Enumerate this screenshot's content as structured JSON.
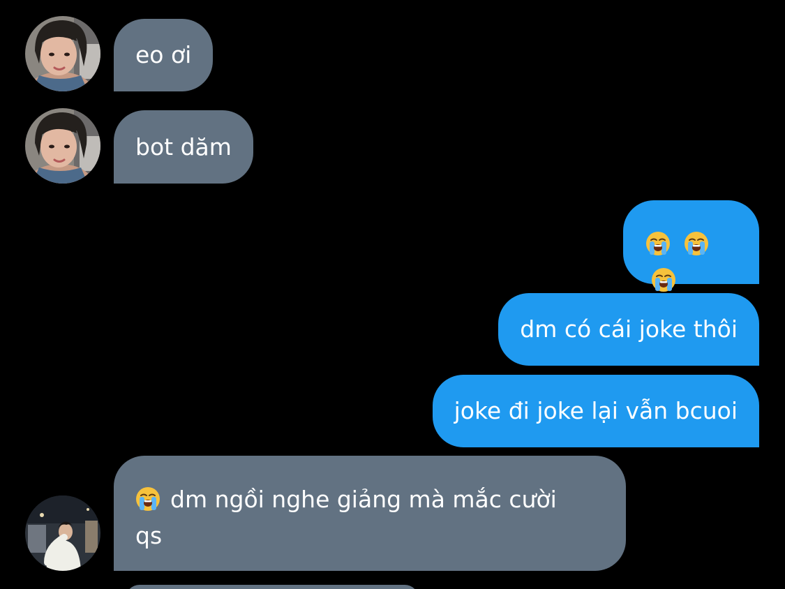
{
  "messages": [
    {
      "sender": "other",
      "text": "eo ơi"
    },
    {
      "sender": "other",
      "text": "bot dăm"
    },
    {
      "sender": "me",
      "emoji": [
        "loudly-crying-face",
        "loudly-crying-face",
        "loudly-crying-face"
      ]
    },
    {
      "sender": "me",
      "text": "dm có cái joke thôi"
    },
    {
      "sender": "me",
      "text": "joke đi joke lại vẫn bcuoi"
    },
    {
      "sender": "other",
      "emoji": "loudly-crying-face",
      "text_line1": "dm ngồi nghe giảng mà mắc cười",
      "text_line2": "qs"
    }
  ],
  "colors": {
    "background": "#000000",
    "incoming_bubble": "#627282",
    "outgoing_bubble": "#1f9af0",
    "text": "#ffffff"
  }
}
